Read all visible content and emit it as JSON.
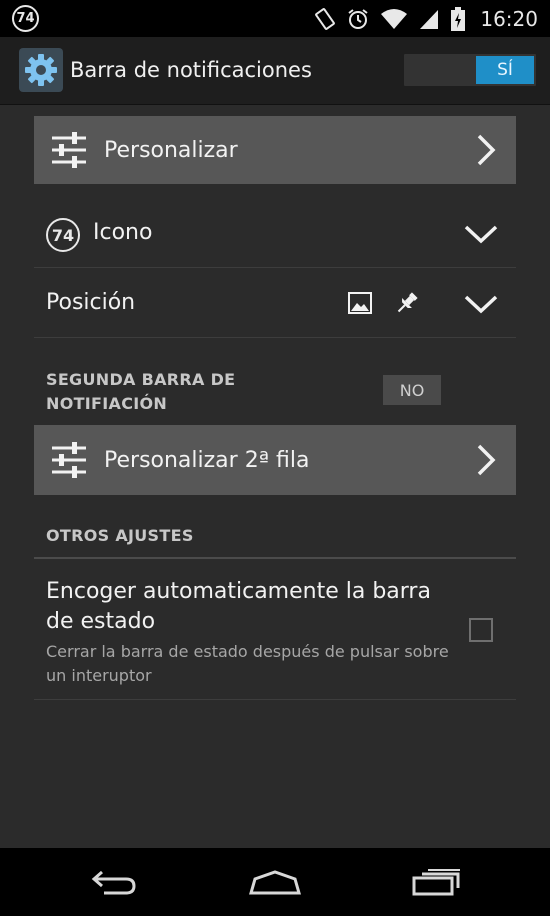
{
  "status_bar": {
    "notification_badge": "74",
    "time": "16:20",
    "icons": [
      "screen-rotation-icon",
      "alarm-icon",
      "wifi-icon",
      "signal-icon",
      "battery-charging-icon"
    ]
  },
  "action_bar": {
    "app_icon": "gear-icon",
    "title": "Barra de notificaciones",
    "master_toggle_label": "SÍ"
  },
  "rows": {
    "customize_label": "Personalizar",
    "icon_label": "Icono",
    "icon_badge": "74",
    "position_label": "Posición"
  },
  "second_bar": {
    "header": "SEGUNDA BARRA DE NOTIFIACIÓN",
    "toggle_label": "NO",
    "customize_label": "Personalizar 2ª fila"
  },
  "other_settings": {
    "header": "OTROS AJUSTES",
    "shrink_title": "Encoger automaticamente la barra de estado",
    "shrink_desc": "Cerrar la barra de estado después de pulsar sobre un interuptor",
    "shrink_checked": false
  },
  "nav_bar": {
    "buttons": [
      "back-icon",
      "home-icon",
      "recent-apps-icon"
    ]
  },
  "colors": {
    "accent": "#1f8fc8",
    "background": "#2b2b2b",
    "row_button": "#575757"
  }
}
